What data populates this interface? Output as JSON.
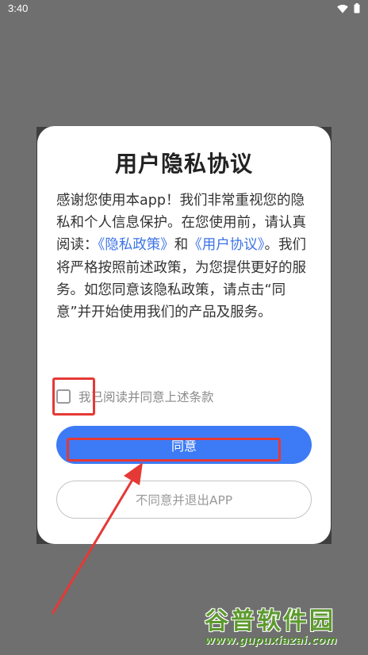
{
  "status_bar": {
    "time": "3:40"
  },
  "dialog": {
    "title": "用户隐私协议",
    "text": {
      "part1": "感谢您使用本app！我们非常重视您的隐私和个人信息保护。在您使用前，请认真阅读：",
      "link_privacy": "《隐私政策》",
      "and": "和",
      "link_user_agreement": "《用户协议》",
      "part2": "。我们将严格按照前述政策，为您提供更好的服务。如您同意该隐私政策，请点击“同意”并开始使用我们的产品及服务。"
    },
    "checkbox_label": "我已阅读并同意上述条款",
    "checkbox_checked": false,
    "agree_button": "同意",
    "disagree_button": "不同意并退出APP"
  },
  "colors": {
    "accent": "#3d7bf6",
    "link": "#3c73e8",
    "annotation": "#e53935"
  },
  "watermark": {
    "title": "谷普软件园",
    "url": "www.gupuxiazai.com"
  }
}
